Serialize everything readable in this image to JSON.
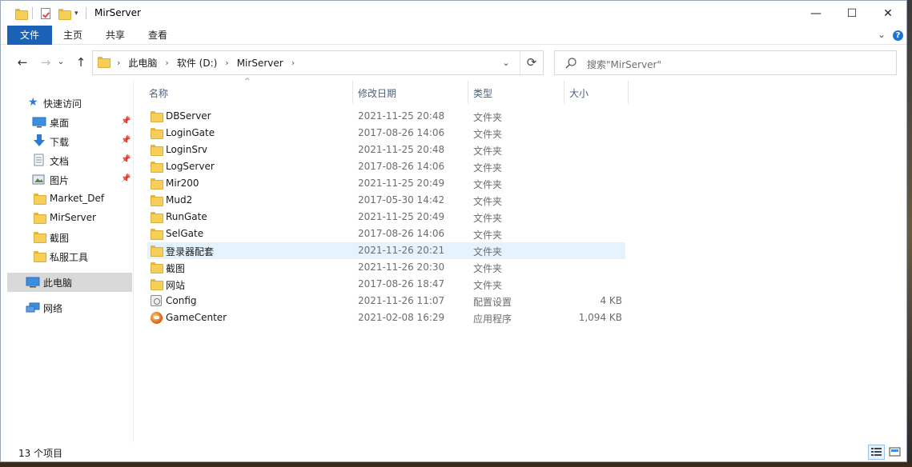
{
  "window": {
    "title": "MirServer"
  },
  "window_controls": {
    "minimize": "—",
    "maximize": "☐",
    "close": "✕"
  },
  "ribbon": {
    "tabs": [
      "文件",
      "主页",
      "共享",
      "查看"
    ],
    "collapse": "⌄",
    "help": "?"
  },
  "nav": {
    "back": "←",
    "forward": "→",
    "recent": "⌄",
    "up": "↑"
  },
  "address": {
    "crumbs": [
      "此电脑",
      "软件 (D:)",
      "MirServer"
    ],
    "sep": "›",
    "end_sep": "›",
    "dropdown": "⌄",
    "refresh": "⟳"
  },
  "search": {
    "placeholder": "搜索\"MirServer\""
  },
  "navpane": {
    "quick_access": "快速访问",
    "items": [
      {
        "label": "桌面",
        "icon": "desktop-icon",
        "pinned": true
      },
      {
        "label": "下载",
        "icon": "download-icon",
        "pinned": true
      },
      {
        "label": "文档",
        "icon": "document-icon",
        "pinned": true
      },
      {
        "label": "图片",
        "icon": "picture-icon",
        "pinned": true
      },
      {
        "label": "Market_Def",
        "icon": "folder-icon",
        "pinned": false
      },
      {
        "label": "MirServer",
        "icon": "folder-icon",
        "pinned": false
      },
      {
        "label": "截图",
        "icon": "folder-icon",
        "pinned": false
      },
      {
        "label": "私服工具",
        "icon": "folder-icon",
        "pinned": false
      }
    ],
    "pin_glyph": "📌",
    "this_pc": "此电脑",
    "network": "网络"
  },
  "columns": {
    "name": "名称",
    "date": "修改日期",
    "type": "类型",
    "size": "大小",
    "sort_caret": "^"
  },
  "files": [
    {
      "name": "DBServer",
      "date": "2021-11-25 20:48",
      "type": "文件夹",
      "size": "",
      "icon": "folder-icon"
    },
    {
      "name": "LoginGate",
      "date": "2017-08-26 14:06",
      "type": "文件夹",
      "size": "",
      "icon": "folder-icon"
    },
    {
      "name": "LoginSrv",
      "date": "2021-11-25 20:48",
      "type": "文件夹",
      "size": "",
      "icon": "folder-icon"
    },
    {
      "name": "LogServer",
      "date": "2017-08-26 14:06",
      "type": "文件夹",
      "size": "",
      "icon": "folder-icon"
    },
    {
      "name": "Mir200",
      "date": "2021-11-25 20:49",
      "type": "文件夹",
      "size": "",
      "icon": "folder-icon"
    },
    {
      "name": "Mud2",
      "date": "2017-05-30 14:42",
      "type": "文件夹",
      "size": "",
      "icon": "folder-icon"
    },
    {
      "name": "RunGate",
      "date": "2021-11-25 20:49",
      "type": "文件夹",
      "size": "",
      "icon": "folder-icon"
    },
    {
      "name": "SelGate",
      "date": "2017-08-26 14:06",
      "type": "文件夹",
      "size": "",
      "icon": "folder-icon"
    },
    {
      "name": "登录器配套",
      "date": "2021-11-26 20:21",
      "type": "文件夹",
      "size": "",
      "icon": "folder-icon",
      "selected": true
    },
    {
      "name": "截图",
      "date": "2021-11-26 20:30",
      "type": "文件夹",
      "size": "",
      "icon": "folder-icon"
    },
    {
      "name": "网站",
      "date": "2017-08-26 18:47",
      "type": "文件夹",
      "size": "",
      "icon": "folder-icon"
    },
    {
      "name": "Config",
      "date": "2021-11-26 11:07",
      "type": "配置设置",
      "size": "4 KB",
      "icon": "config-file-icon"
    },
    {
      "name": "GameCenter",
      "date": "2021-02-08 16:29",
      "type": "应用程序",
      "size": "1,094 KB",
      "icon": "application-icon"
    }
  ],
  "status": {
    "count": "13 个项目"
  },
  "colors": {
    "file_tab": "#1a62b8",
    "selection": "#e5f3ff",
    "nav_selected": "#d9d9d9",
    "folder": "#f6ce5a"
  }
}
